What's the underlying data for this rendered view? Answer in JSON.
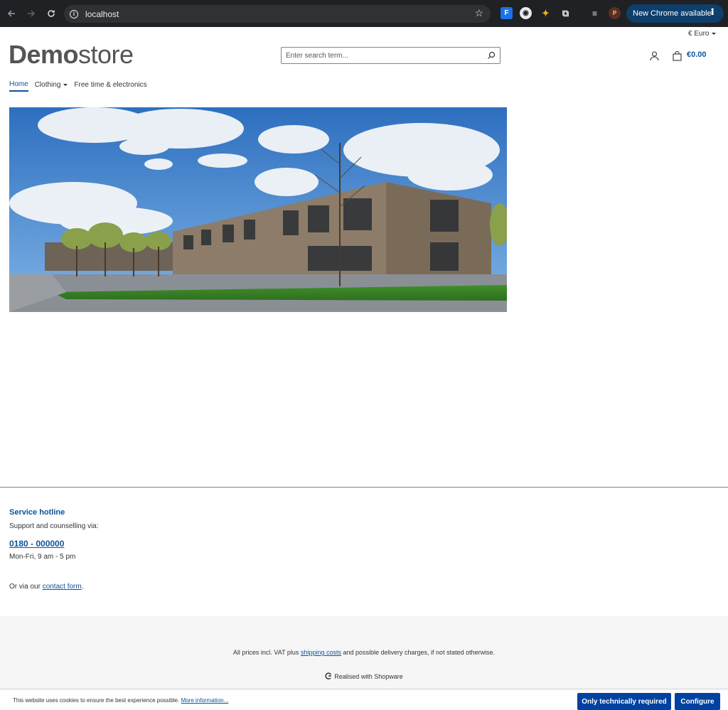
{
  "browser": {
    "url": "localhost",
    "new_chrome_label": "New Chrome available",
    "profile_initial": "P",
    "ext_1_label": "F"
  },
  "header": {
    "currency": "€ Euro",
    "logo_bold": "Demo",
    "logo_regular": "store",
    "search_placeholder": "Enter search term...",
    "cart_total": "€0.00"
  },
  "nav": {
    "items": [
      {
        "label": "Home",
        "active": true
      },
      {
        "label": "Clothing",
        "dropdown": true
      },
      {
        "label": "Free time & electronics"
      }
    ]
  },
  "footer": {
    "hotline_title": "Service hotline",
    "hotline_sub": "Support and counselling via:",
    "hotline_number": "0180 - 000000",
    "hotline_hours": "Mon-Fri, 9 am - 5 pm",
    "contact_prefix": "Or via our ",
    "contact_link": "contact form",
    "contact_suffix": ".",
    "vat_prefix": "All prices incl. VAT plus ",
    "vat_link": "shipping costs",
    "vat_suffix": " and possible delivery charges, if not stated otherwise.",
    "realised": "Realised with Shopware"
  },
  "cookie": {
    "text": "This website uses cookies to ensure the best experience possible. ",
    "more_link": "More information...",
    "btn_required": "Only technically required",
    "btn_configure": "Configure"
  },
  "colors": {
    "brand": "#0b539b",
    "button": "#0042a0",
    "chrome_bg": "#202124"
  }
}
